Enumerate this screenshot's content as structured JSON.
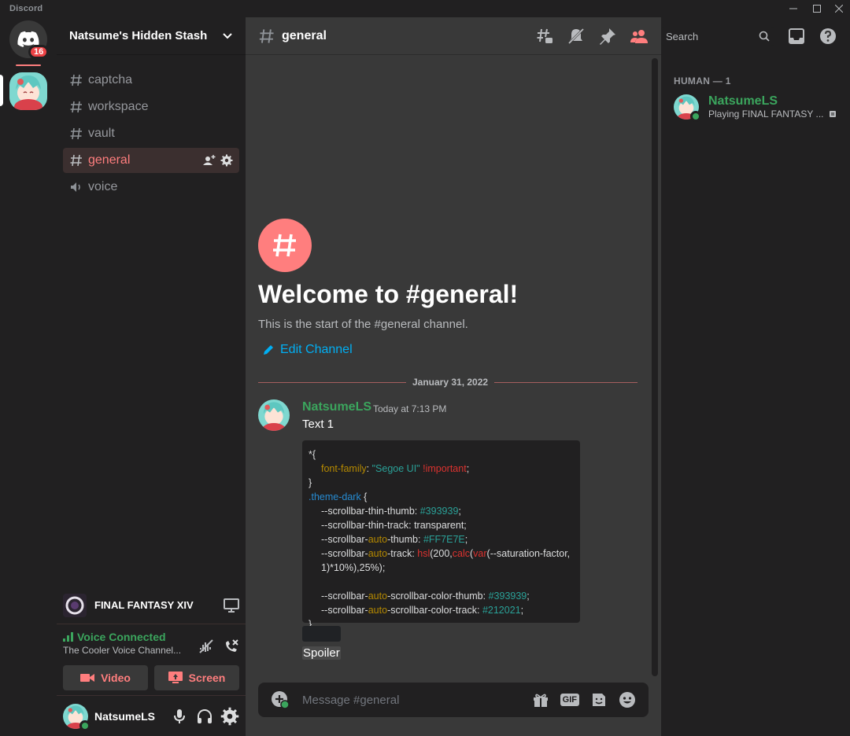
{
  "app": {
    "title": "Discord"
  },
  "rail": {
    "notification_count": "16"
  },
  "server": {
    "name": "Natsume's Hidden Stash"
  },
  "channels": [
    {
      "name": "captcha",
      "type": "text"
    },
    {
      "name": "workspace",
      "type": "text"
    },
    {
      "name": "vault",
      "type": "text"
    },
    {
      "name": "general",
      "type": "text",
      "active": true
    },
    {
      "name": "voice",
      "type": "voice"
    }
  ],
  "game": {
    "name": "FINAL FANTASY XIV"
  },
  "voice": {
    "status": "Voice Connected",
    "channel": "The Cooler Voice Channel...",
    "video_label": "Video",
    "screen_label": "Screen"
  },
  "user": {
    "name": "NatsumeLS"
  },
  "header": {
    "channel": "general",
    "search_placeholder": "Search"
  },
  "welcome": {
    "title": "Welcome to #general!",
    "subtitle": "This is the start of the #general channel.",
    "edit_label": "Edit Channel"
  },
  "divider": {
    "date": "January 31, 2022"
  },
  "message": {
    "author": "NatsumeLS",
    "timestamp": "Today at 7:13 PM",
    "text": "Text 1",
    "spoiler": "Spoiler",
    "code": {
      "line1": "*{",
      "prop_font": "font-family",
      "val_font": "\"Segoe UI\"",
      "important": "!important",
      "close1": "}",
      "selector": ".theme-dark",
      "open2": " {",
      "l_thin_thumb": "--scrollbar-thin-thumb: ",
      "v_thin_thumb": "#393939",
      "l_thin_track": "--scrollbar-thin-track: transparent;",
      "l_auto_thumb_a": "--scrollbar-",
      "auto": "auto",
      "l_auto_thumb_b": "-thumb: ",
      "v_auto_thumb": "#FF7E7E",
      "l_auto_track_b": "-track: ",
      "hsl": "hsl",
      "hsl_open": "(200,",
      "calc": "calc",
      "calc_open": "(",
      "var": "var",
      "var_body": "(--saturation-factor, 1)*10%),25%);",
      "l_color_thumb_b": "-scrollbar-color-thumb: ",
      "v_color_thumb": "#393939",
      "l_color_track_b": "-scrollbar-color-track: ",
      "v_color_track": "#212021",
      "close2": "}"
    }
  },
  "composer": {
    "placeholder": "Message #general",
    "gif_label": "GIF"
  },
  "members": {
    "role_heading": "HUMAN — 1",
    "list": [
      {
        "name": "NatsumeLS",
        "activity": "Playing FINAL FANTASY ..."
      }
    ]
  },
  "colors": {
    "accent": "#ff7e7e",
    "online": "#3ba55d",
    "link": "#00aff4",
    "background": "#393939",
    "sidebar": "#212021"
  }
}
